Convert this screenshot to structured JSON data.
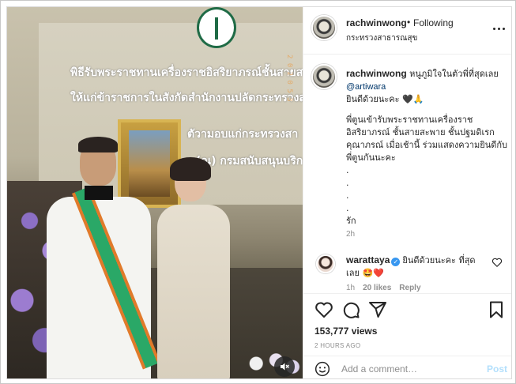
{
  "post": {
    "author": "rachwinwong",
    "follow_dot": "•",
    "follow_status": "Following",
    "location": "กระทรวงสาธารณสุข"
  },
  "media": {
    "banner_lines": [
      "พิธีรับพระราชทานเครื่องราชอิสริยาภรณ์ชั้นสายสะพาย",
      "ให้แก่ข้าราชการในสังกัดสำนักงานปลัดกระทรวงสาธารณสุข",
      "ตัวามอบแก่กระทรวงสา",
      "ฯ (ณ) กรมสนับสนุนบริก"
    ],
    "side_code": "2 0 2 0  5 3",
    "mute_icon": "speaker-muted-icon"
  },
  "caption": {
    "username": "rachwinwong",
    "first_text": "หนูภูมิใจในตัวพี่ที่สุดเลย",
    "mention": "@artiwara",
    "line2": "ยินดีด้วยนะคะ 🖤🙏",
    "body_lines": [
      "พี่ตูนเข้ารับพระราชทานเครื่องราช",
      "อิสริยาภรณ์ ชั้นสายสะพาย ชั้นปฐมดิเรก",
      "คุณาภรณ์ เมื่อเช้านี้ ร่วมแสดงความยินดีกับ",
      "พี่ตูนกันนะคะ"
    ],
    "dots": [
      ".",
      ".",
      ".",
      "."
    ],
    "sign_off": "รัก",
    "time": "2h"
  },
  "comment": {
    "username": "warattaya",
    "text": "ยินดีด้วยนะคะ ที่สุดเลย 🤩❤️",
    "time": "1h",
    "likes": "20 likes",
    "reply_label": "Reply"
  },
  "stats": {
    "views": "153,777 views",
    "timestamp": "2 HOURS AGO"
  },
  "compose": {
    "placeholder": "Add a comment…",
    "post_label": "Post"
  },
  "colors": {
    "link": "#00376b",
    "muted": "#8e8e8e",
    "verified": "#3897f0",
    "post_disabled": "#b2dffc"
  }
}
